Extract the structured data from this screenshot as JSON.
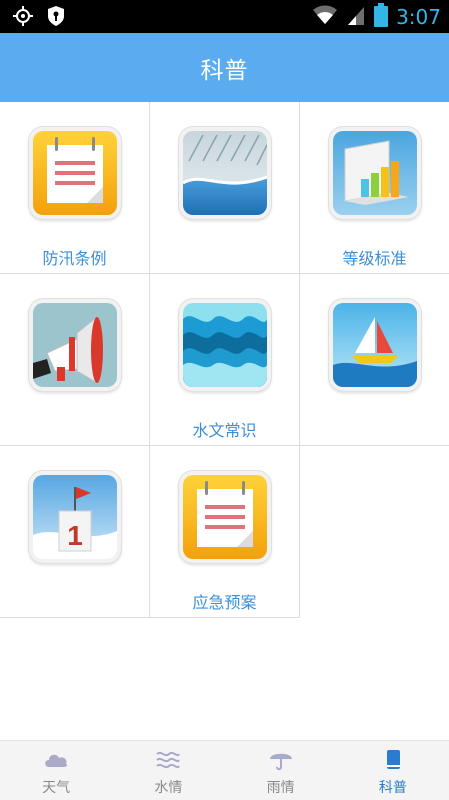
{
  "status_bar": {
    "time": "3:07",
    "icons": [
      "gps-icon",
      "shield-icon",
      "wifi-icon",
      "signal-icon",
      "battery-icon"
    ]
  },
  "header": {
    "title": "科普"
  },
  "grid": {
    "items": [
      {
        "label": "防汛条例",
        "icon": "notepad-icon"
      },
      {
        "label": "",
        "icon": "rain-icon"
      },
      {
        "label": "等级标准",
        "icon": "bar-chart-icon"
      },
      {
        "label": "",
        "icon": "megaphone-icon"
      },
      {
        "label": "水文常识",
        "icon": "waves-icon"
      },
      {
        "label": "",
        "icon": "sailboat-icon"
      },
      {
        "label": "",
        "icon": "flag-marker-icon"
      },
      {
        "label": "应急预案",
        "icon": "notepad-icon"
      }
    ]
  },
  "bottom_nav": {
    "items": [
      {
        "label": "天气",
        "icon": "cloud-icon",
        "active": false
      },
      {
        "label": "水情",
        "icon": "water-waves-icon",
        "active": false
      },
      {
        "label": "雨情",
        "icon": "umbrella-icon",
        "active": false
      },
      {
        "label": "科普",
        "icon": "book-icon",
        "active": true
      }
    ]
  },
  "colors": {
    "header_bg": "#5aabef",
    "label_text": "#3a8fd8",
    "nav_active": "#2a7cd0",
    "nav_inactive": "#8a8a8a",
    "status_time": "#33b5e5"
  }
}
